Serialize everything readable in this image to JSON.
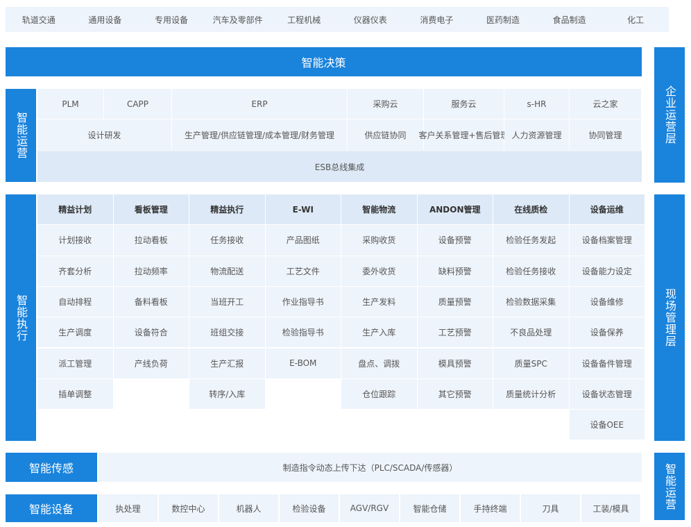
{
  "industries": [
    "轨道交通",
    "通用设备",
    "专用设备",
    "汽车及零部件",
    "工程机械",
    "仪器仪表",
    "消费电子",
    "医药制造",
    "食品制造",
    "化工"
  ],
  "decision": "智能决策",
  "right_labels": {
    "enterprise": "企业运营层",
    "field": "现场管理层",
    "bottom": "智能运营"
  },
  "operation": {
    "label": "智能运营",
    "top_row": [
      "PLM",
      "CAPP",
      "ERP",
      "采购云",
      "服务云",
      "s-HR",
      "云之家"
    ],
    "second_row": [
      "设计研发",
      "生产管理/供应链管理/成本管理/财务管理",
      "供应链协同",
      "客户关系管理+售后管理",
      "人力资源管理",
      "协同管理"
    ],
    "esb": "ESB总线集成"
  },
  "execution": {
    "label": "智能执行",
    "columns": [
      {
        "header": "精益计划",
        "items": [
          "计划接收",
          "齐套分析",
          "自动排程",
          "生产调度",
          "派工管理",
          "插单调整"
        ]
      },
      {
        "header": "看板管理",
        "items": [
          "拉动看板",
          "拉动频率",
          "备料看板",
          "设备符合",
          "产线负荷"
        ]
      },
      {
        "header": "精益执行",
        "items": [
          "任务接收",
          "物流配送",
          "当班开工",
          "班组交接",
          "生产汇报",
          "转序/入库"
        ]
      },
      {
        "header": "E-WI",
        "items": [
          "产品图纸",
          "工艺文件",
          "作业指导书",
          "检验指导书",
          "E-BOM"
        ]
      },
      {
        "header": "智能物流",
        "items": [
          "采购收货",
          "委外收货",
          "生产发料",
          "生产入库",
          "盘点、调拨",
          "仓位跟踪"
        ]
      },
      {
        "header": "ANDON管理",
        "items": [
          "设备预警",
          "缺料预警",
          "质量预警",
          "工艺预警",
          "模具预警",
          "其它预警"
        ]
      },
      {
        "header": "在线质检",
        "items": [
          "检验任务发起",
          "检验任务接收",
          "检验数据采集",
          "不良品处理",
          "质量SPC",
          "质量统计分析"
        ]
      },
      {
        "header": "设备运维",
        "items": [
          "设备档案管理",
          "设备能力设定",
          "设备维修",
          "设备保养",
          "设备备件管理",
          "设备状态管理",
          "设备OEE"
        ]
      }
    ]
  },
  "sensing": {
    "label": "智能传感",
    "text": "制造指令动态上传下达（PLC/SCADA/传感器）"
  },
  "equipment": {
    "label": "智能设备",
    "items": [
      "执处理",
      "数控中心",
      "机器人",
      "检验设备",
      "AGV/RGV",
      "智能仓储",
      "手持终端",
      "刀具",
      "工装/模具"
    ]
  }
}
